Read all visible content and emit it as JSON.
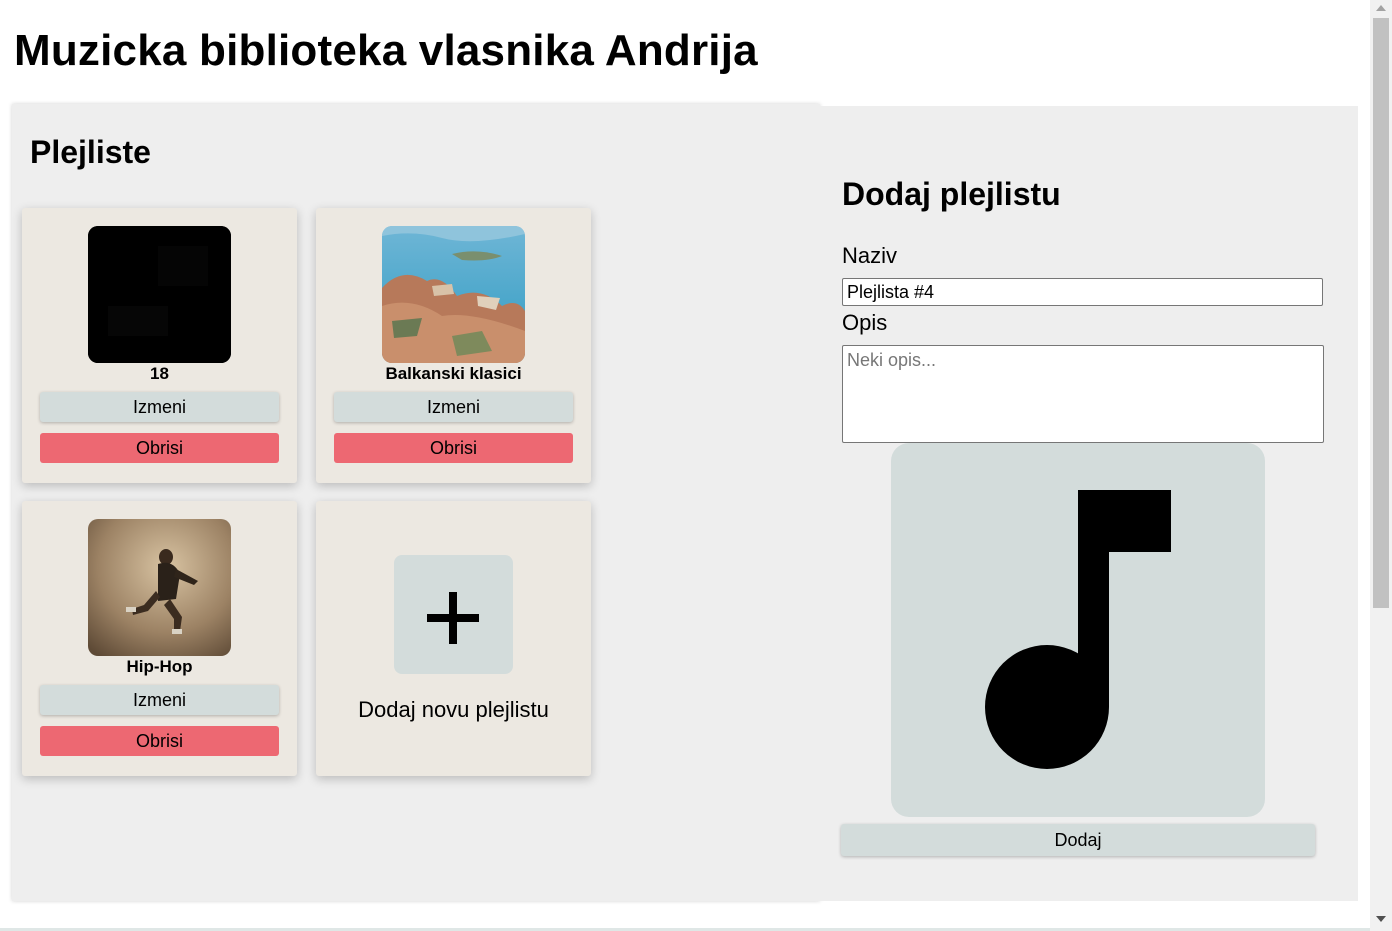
{
  "page": {
    "title": "Muzicka biblioteka vlasnika Andrija"
  },
  "playlists_section": {
    "title": "Plejliste",
    "cards": [
      {
        "name": "18",
        "edit_label": "Izmeni",
        "delete_label": "Obrisi",
        "cover_icon": "black-cover-image"
      },
      {
        "name": "Balkanski klasici",
        "edit_label": "Izmeni",
        "delete_label": "Obrisi",
        "cover_icon": "aerial-coastal-city-image"
      },
      {
        "name": "Hip-Hop",
        "edit_label": "Izmeni",
        "delete_label": "Obrisi",
        "cover_icon": "jumping-person-image"
      }
    ],
    "add_card": {
      "label": "Dodaj novu plejlistu",
      "icon": "plus-icon"
    }
  },
  "add_form": {
    "title": "Dodaj plejlistu",
    "name_label": "Naziv",
    "name_value": "Plejlista #4",
    "description_label": "Opis",
    "description_placeholder": "Neki opis...",
    "image_icon": "music-note-icon",
    "submit_label": "Dodaj"
  },
  "colors": {
    "panel_bg": "#eeeeee",
    "card_bg": "#ece8e1",
    "secondary_button": "#d3dcdb",
    "danger_button": "#ed6872"
  }
}
